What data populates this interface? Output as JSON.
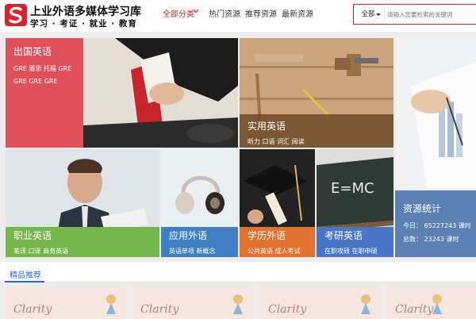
{
  "header": {
    "title": "上业外语多媒体学习库",
    "subtitle": "学习 · 考证 · 就业 · 教育",
    "nav": [
      "全部分类",
      "热门资源",
      "推荐资源",
      "最新资源"
    ],
    "search": {
      "scope": "全部",
      "placeholder": "请输入您要检索的关键词"
    }
  },
  "tiles": {
    "abroad": {
      "title": "出国英语",
      "line1": "GRE 雅思 托福 GRE",
      "line2": "GRE GRE GRE"
    },
    "practical": {
      "title": "实用英语",
      "subtitle": "听力 口语 词汇 阅读"
    },
    "career": {
      "title": "职业英语",
      "subtitle": "笔译 口译 商务英语"
    },
    "applied": {
      "title": "应用外语",
      "subtitle": "英语单项 新概念"
    },
    "education": {
      "title": "学历外语",
      "subtitle": "公共英语 成人考试"
    },
    "postgrad": {
      "title": "考研英语",
      "subtitle": "在职攻硕 在职申硕"
    },
    "stats": {
      "title": "资源统计",
      "today": "今日： 65227243 课时",
      "total": "总数： 23243 课时"
    }
  },
  "section": {
    "title": "精品推荐"
  },
  "cards": [
    "Clarity",
    "Clarity",
    "Clarity",
    "Clarity"
  ],
  "colors": {
    "brand_red": "#d8232a",
    "accent_blue": "#2a6fd6"
  },
  "icons": [
    "logo-icon",
    "chevron-down-icon",
    "caret-down-icon"
  ]
}
